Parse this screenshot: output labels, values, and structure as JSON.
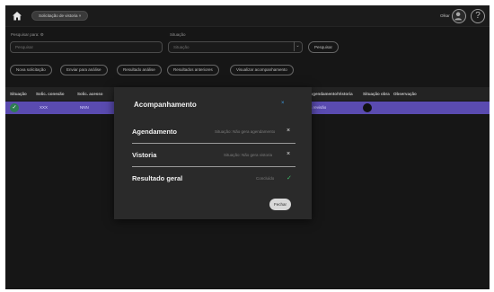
{
  "header": {
    "tab_label": "Solicitação de vistoria  ×",
    "user_name": "Olkar",
    "help_label": "?"
  },
  "filters": {
    "search_label": "Pesquisar para: ⚙",
    "search_placeholder": "Pesquisar",
    "status_label": "Situação",
    "status_value": "Situação",
    "search_button": "Pesquisar"
  },
  "actions": [
    "Nova solicitação",
    "Enviar para análise",
    "Resultado análise",
    "Resultados anteriores",
    "Visualizar acompanhamento"
  ],
  "table": {
    "headers": [
      "Situação",
      "Solic. conexão",
      "Solic. acesso",
      "Agendamento/Vistoria",
      "Situação obra",
      "Observação"
    ],
    "row": {
      "col2": "XXX",
      "col3": "NNN",
      "agendamento": "a revisão"
    }
  },
  "modal": {
    "title": "Acompanhamento",
    "close_icon": "×",
    "steps": [
      {
        "title": "Agendamento",
        "status": "Situação: Não gera agendamento",
        "icon": "×"
      },
      {
        "title": "Vistoria",
        "status": "Situação: Não gera vistoria",
        "icon": "×"
      },
      {
        "title": "Resultado geral",
        "status": "Concluído",
        "icon": "✓"
      }
    ],
    "close_button": "Fechar"
  },
  "colors": {
    "accent": "#5a4bb0",
    "success": "#3fbf6a",
    "link": "#3d9be0"
  }
}
